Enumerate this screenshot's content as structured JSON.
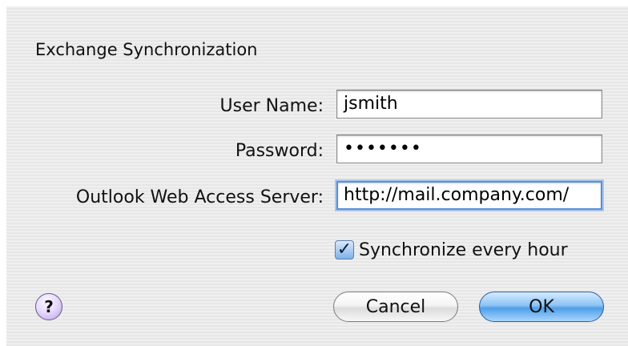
{
  "dialog": {
    "title": "Exchange Synchronization"
  },
  "form": {
    "username": {
      "label": "User Name:",
      "value": "jsmith"
    },
    "password": {
      "label": "Password:",
      "value": "•••••••"
    },
    "server": {
      "label": "Outlook Web Access Server:",
      "value": "http://mail.company.com/"
    }
  },
  "options": {
    "sync_label": "Synchronize every hour",
    "sync_checked": true,
    "check_glyph": "✓"
  },
  "help": {
    "label": "?",
    "icon": "help-icon"
  },
  "buttons": {
    "cancel_label": "Cancel",
    "ok_label": "OK"
  },
  "colors": {
    "default_button": "#4f9ee8",
    "focus_ring": "#5b8fd6",
    "help_button": "#e8dbff"
  }
}
